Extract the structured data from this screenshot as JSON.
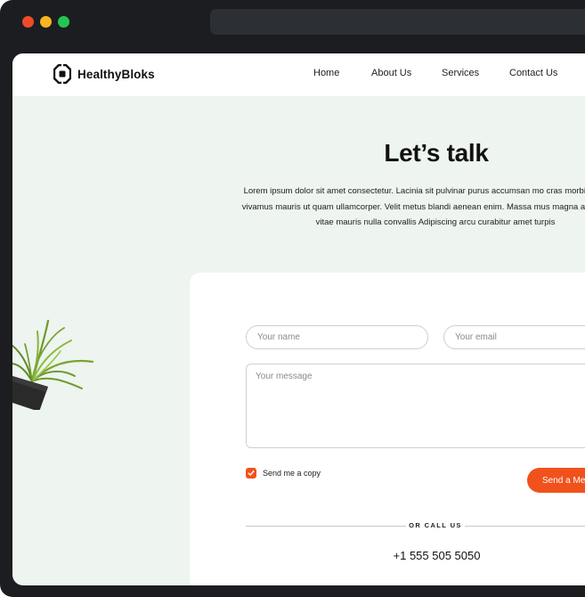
{
  "window": {
    "controls": [
      "close",
      "minimize",
      "maximize"
    ],
    "colors": {
      "close": "#ee4b2b",
      "minimize": "#f5b520",
      "maximize": "#23c552",
      "frame": "#1b1d20"
    }
  },
  "brand": {
    "name": "HealthyBloks",
    "icon": "healthybloks-logo-icon"
  },
  "nav": {
    "home": "Home",
    "about": "About Us",
    "services": "Services",
    "contact": "Contact Us"
  },
  "hero": {
    "title": "Let’s talk",
    "text": "Lorem ipsum dolor sit amet consectetur. Lacinia sit pulvinar purus accumsan mo cras morbi amet vitae vivamus mauris ut quam ullamcorper. Velit metus blandi aenean enim. Massa mus magna amet facilisis vitae mauris nulla convallis Adipiscing arcu curabitur amet turpis"
  },
  "form": {
    "name_placeholder": "Your name",
    "email_placeholder": "Your email",
    "message_placeholder": "Your message",
    "send_copy_label": "Send me a copy",
    "send_copy_checked": true,
    "send_button": "Send a Me"
  },
  "call": {
    "label": "OR CALL US",
    "phone": "+1 555 505 5050"
  },
  "colors": {
    "accent": "#f1511b",
    "page_bg": "#eef4ef",
    "card_bg": "#ffffff"
  }
}
